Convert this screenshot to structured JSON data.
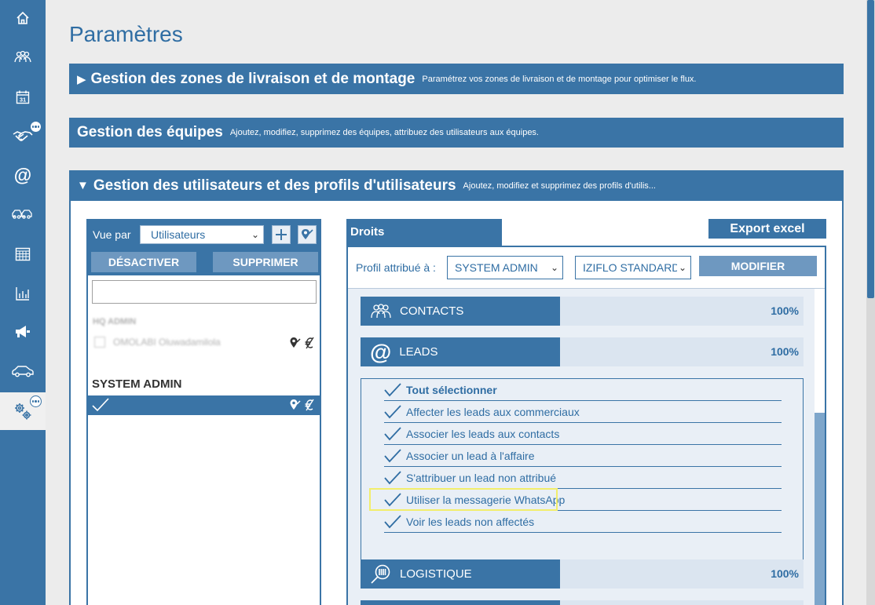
{
  "page": {
    "title": "Paramètres"
  },
  "sidebar": {
    "items": [
      {
        "name": "home-icon"
      },
      {
        "name": "contacts-icon"
      },
      {
        "name": "calendar-icon",
        "label": "31"
      },
      {
        "name": "handshake-icon"
      },
      {
        "name": "at-icon",
        "label": "@"
      },
      {
        "name": "fleet-icon"
      },
      {
        "name": "table-icon"
      },
      {
        "name": "stats-icon"
      },
      {
        "name": "megaphone-icon"
      },
      {
        "name": "car-icon"
      },
      {
        "name": "settings-icon"
      }
    ]
  },
  "sections": {
    "zones": {
      "arrow": "▶",
      "title": "Gestion des zones de livraison et de montage",
      "desc": "Paramétrez vos zones de livraison et de montage pour optimiser le flux."
    },
    "teams": {
      "title": "Gestion des équipes",
      "desc": "Ajoutez, modifiez, supprimez des équipes, attribuez des utilisateurs aux équipes."
    },
    "users": {
      "arrow": "▼",
      "title": "Gestion des utilisateurs et des profils d'utilisateurs",
      "desc": "Ajoutez, modifiez et supprimez des profils d'utilis..."
    }
  },
  "left_panel": {
    "vue_label": "Vue par",
    "vue_value": "Utilisateurs",
    "deactivate_label": "DÉSACTIVER",
    "delete_label": "SUPPRIMER",
    "search_value": "",
    "blurred_group": "HQ ADMIN",
    "blurred_user": "OMOLABI Oluwadamilola",
    "group_title": "SYSTEM ADMIN"
  },
  "right_panel": {
    "tab_label": "Droits",
    "export_label": "Export excel",
    "profil_label": "Profil attribué à :",
    "profil_value": "SYSTEM ADMIN",
    "standard_value": "IZIFLO STANDARD",
    "modify_label": "MODIFIER",
    "modules": [
      {
        "name": "CONTACTS",
        "percent": "100%",
        "icon": "contacts-icon"
      },
      {
        "name": "LEADS",
        "percent": "100%",
        "icon": "at-icon"
      },
      {
        "name": "LOGISTIQUE",
        "percent": "100%",
        "icon": "logistics-icon"
      }
    ],
    "lead_rights": [
      "Tout sélectionner",
      "Affecter les leads aux commerciaux",
      "Associer les leads aux contacts",
      "Associer un lead à l'affaire",
      "S'attribuer un lead non attribué",
      "Utiliser la messagerie WhatsApp",
      "Voir les leads non affectés"
    ]
  },
  "colors": {
    "primary": "#3a74a6",
    "muted_button": "#6e98c0",
    "module_bg": "#dbe5f0",
    "panel_bg": "#e9eff6",
    "highlight": "#f2ee6c"
  }
}
